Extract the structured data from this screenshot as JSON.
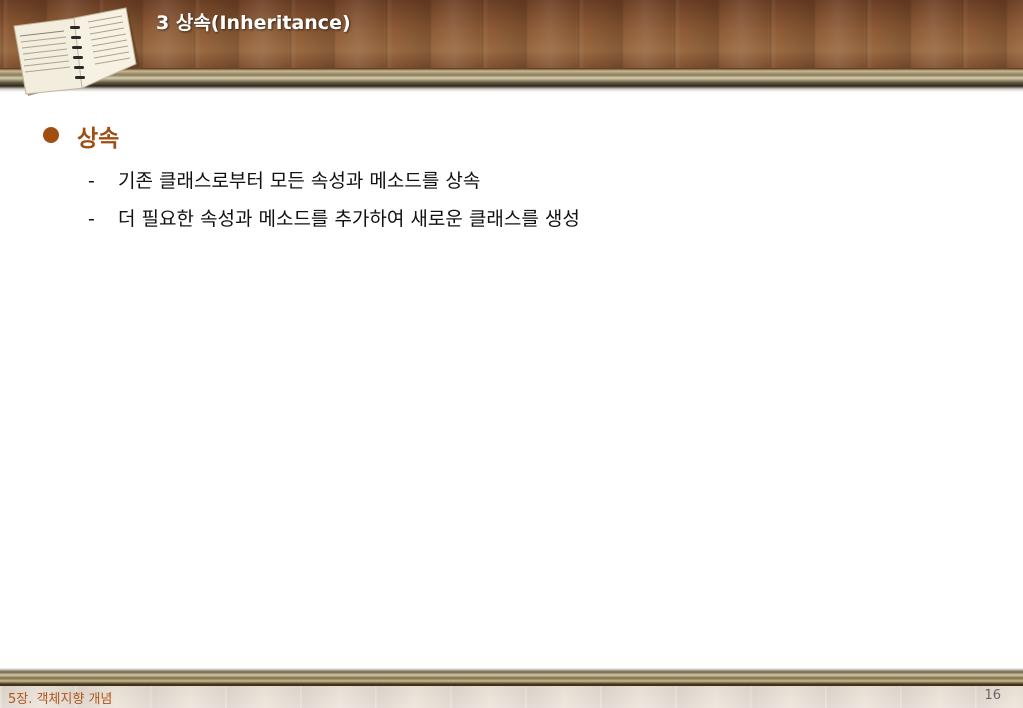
{
  "header": {
    "title": "3 상속(Inheritance)"
  },
  "content": {
    "heading": "상속",
    "items": [
      "기존 클래스로부터 모든 속성과 메소드를 상속",
      "더 필요한 속성과 메소드를 추가하여 새로운 클래스를 생성"
    ],
    "dash": "-"
  },
  "footer": {
    "chapter": "5장. 객체지향 개념",
    "page_number": "16"
  },
  "colors": {
    "accent": "#a14e12",
    "footer_text": "#b0561d",
    "wood_dark": "#6b3f24",
    "wood_light": "#9a6a42"
  },
  "icons": {
    "header_decoration": "open-book-icon",
    "bullet": "bullet-dot-icon"
  }
}
